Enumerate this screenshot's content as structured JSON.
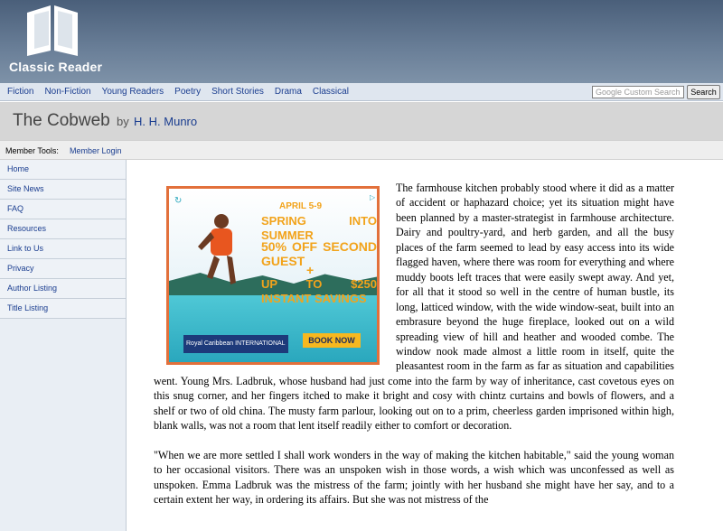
{
  "site": {
    "logo_text": "Classic Reader",
    "logo_icon": "open-book-icon"
  },
  "nav": {
    "links": [
      "Fiction",
      "Non-Fiction",
      "Young Readers",
      "Poetry",
      "Short Stories",
      "Drama",
      "Classical"
    ],
    "search_placeholder": "Google Custom Search",
    "search_button": "Search"
  },
  "book": {
    "title": "The Cobweb",
    "by": "by",
    "author": "H. H. Munro"
  },
  "member": {
    "label": "Member Tools:",
    "login": "Member Login"
  },
  "sidebar": {
    "items": [
      "Home",
      "Site News",
      "FAQ",
      "Resources",
      "Link to Us",
      "Privacy",
      "Author Listing",
      "Title Listing"
    ]
  },
  "ad": {
    "date": "APRIL 5-9",
    "headline": "SPRING INTO SUMMER",
    "offer": "50% OFF SECOND GUEST",
    "plus": "+",
    "savings": "UP TO $250 INSTANT SAVINGS",
    "cta": "BOOK NOW",
    "brand": "Royal Caribbean INTERNATIONAL",
    "colors": {
      "accent": "#f2a31b",
      "border": "#e2703b",
      "water": "#2fa8bf"
    }
  },
  "content": {
    "paragraphs": [
      "The farmhouse kitchen probably stood where it did as a matter of accident or haphazard choice; yet its situation might have been planned by a master-strategist in farmhouse architecture. Dairy and poultry-yard, and herb garden, and all the busy places of the farm seemed to lead by easy access into its wide flagged haven, where there was room for everything and where muddy boots left traces that were easily swept away. And yet, for all that it stood so well in the centre of human bustle, its long, latticed window, with the wide window-seat, built into an embrasure beyond the huge fireplace, looked out on a wild spreading view of hill and heather and wooded combe. The window nook made almost a little room in itself, quite the pleasantest room in the farm as far as situation and capabilities went. Young Mrs. Ladbruk, whose husband had just come into the farm by way of inheritance, cast covetous eyes on this snug corner, and her fingers itched to make it bright and cosy with chintz curtains and bowls of flowers, and a shelf or two of old china. The musty farm parlour, looking out on to a prim, cheerless garden imprisoned within high, blank walls, was not a room that lent itself readily either to comfort or decoration.",
      "\"When we are more settled I shall work wonders in the way of making the kitchen habitable,\" said the young woman to her occasional visitors. There was an unspoken wish in those words, a wish which was unconfessed as well as unspoken. Emma Ladbruk was the mistress of the farm; jointly with her husband she might have her say, and to a certain extent her way, in ordering its affairs. But she was not mistress of the"
    ]
  }
}
